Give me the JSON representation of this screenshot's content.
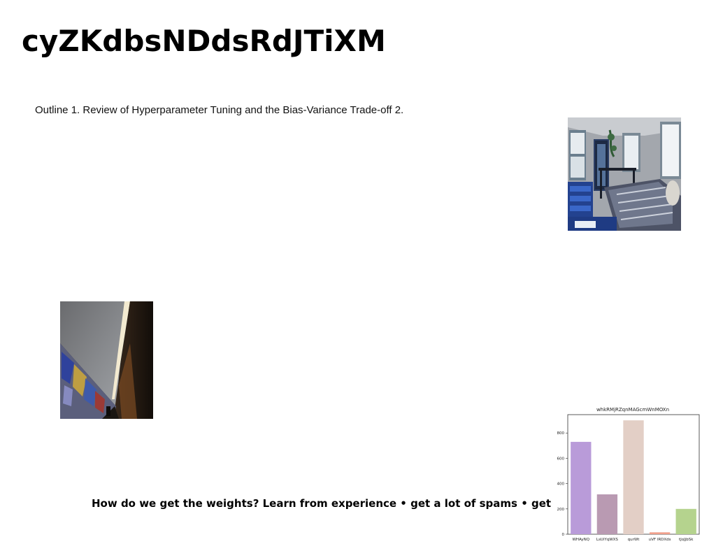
{
  "slide": {
    "title": "cyZKdbsNDdsRdJTiXM",
    "outline": "Outline 1. Review of Hyperparameter Tuning and the Bias-Variance Trade-off 2.",
    "footer": "How do we get the weights? Learn from experience • get a lot of spams • get"
  },
  "chart_data": {
    "type": "bar",
    "title": "whkRMjRZqnMAGcmWnMOXn",
    "categories": [
      "WHAyNQ",
      "LsUiYqWXS",
      "qurWt",
      "uVF lRDXds",
      "tJoJjbSk"
    ],
    "values": [
      730,
      315,
      900,
      15,
      200
    ],
    "colors": [
      "#b99bd9",
      "#b99ab2",
      "#e3cfc6",
      "#f0a08c",
      "#b5d38e"
    ],
    "yticks": [
      0,
      200,
      400,
      600,
      800
    ],
    "ylim": [
      0,
      945
    ],
    "grid": false
  }
}
